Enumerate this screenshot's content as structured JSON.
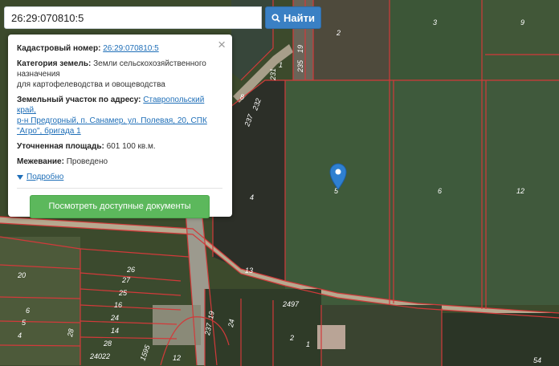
{
  "search": {
    "value": "26:29:070810:5",
    "button_label": "Найти",
    "button_icon": "search-icon"
  },
  "popup": {
    "cadastral_label": "Кадастровый номер:",
    "cadastral_value": "26:29:070810:5",
    "category_label": "Категория земель:",
    "category_value_line1": "Земли сельскохозяйственного",
    "category_value_line2": "назначения",
    "usage": "для картофелеводства и овощеводства",
    "address_label": "Земельный участок по адресу:",
    "address_line1": "Ставропольский край,",
    "address_line2": "р-н Предгорный, п. Санамер, ул. Полевая, 20, СПК",
    "address_line3": "\"Агро\", бригада 1",
    "area_label": "Уточненная площадь:",
    "area_value": "601 100 кв.м.",
    "survey_label": "Межевание:",
    "survey_value": "Проведено",
    "more_label": "Подробно",
    "docs_button_label": "Посмотреть доступные документы",
    "close_icon": "close-icon"
  },
  "map": {
    "parcel_labels": {
      "p2": "2",
      "p3": "3",
      "p9": "9",
      "p1": "1",
      "p231": "231",
      "p235": "235",
      "p19": "19",
      "p8": "8",
      "p237": "237",
      "p232": "232",
      "p4": "4",
      "p5": "5",
      "p6": "6",
      "p12": "12",
      "p13": "13",
      "p20": "20",
      "p26": "26",
      "p27": "27",
      "p25": "25",
      "p16": "16",
      "p24": "24",
      "p14": "14",
      "p28": "28",
      "p6b": "6",
      "p5b": "5",
      "p4b": "4",
      "p2497": "2497",
      "p237b": "237",
      "p19b": "19",
      "p24b": "24",
      "p2b": "2",
      "p1b": "1",
      "p12b": "12",
      "p1595": "1595",
      "p24022": "24022",
      "p28b": "28",
      "p54": "54"
    },
    "marker_icon": "map-pin-icon",
    "line_color": "#d23a3a"
  }
}
